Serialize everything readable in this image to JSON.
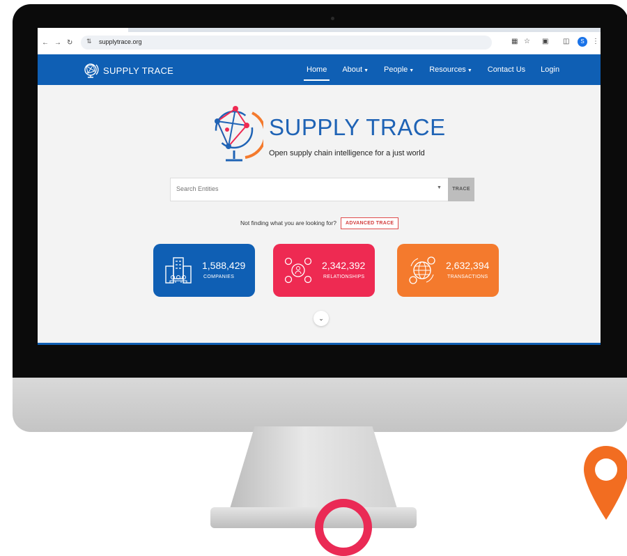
{
  "browser": {
    "url": "supplytrace.org",
    "profile_initial": "S"
  },
  "site_nav": {
    "brand": "SUPPLY TRACE",
    "items": [
      {
        "label": "Home",
        "active": true
      },
      {
        "label": "About",
        "dropdown": true
      },
      {
        "label": "People",
        "dropdown": true
      },
      {
        "label": "Resources",
        "dropdown": true
      },
      {
        "label": "Contact Us"
      },
      {
        "label": "Login"
      }
    ]
  },
  "hero": {
    "title": "SUPPLY TRACE",
    "tagline": "Open supply chain intelligence for a just world"
  },
  "search": {
    "placeholder": "Search Entities",
    "button": "TRACE"
  },
  "advanced": {
    "prompt": "Not finding what you are looking for?",
    "button": "ADVANCED TRACE"
  },
  "stats": [
    {
      "value": "1,588,429",
      "label": "COMPANIES",
      "color": "#0f5fb4",
      "icon": "buildings-icon"
    },
    {
      "value": "2,342,392",
      "label": "RELATIONSHIPS",
      "color": "#ee2a52",
      "icon": "people-network-icon"
    },
    {
      "value": "2,632,394",
      "label": "TRANSACTIONS",
      "color": "#f47a2d",
      "icon": "globe-money-icon"
    }
  ],
  "colors": {
    "brand_blue": "#0f5fb4",
    "accent_red": "#ee2a52",
    "accent_orange": "#f47a2d",
    "page_bg": "#f3f3f3"
  }
}
